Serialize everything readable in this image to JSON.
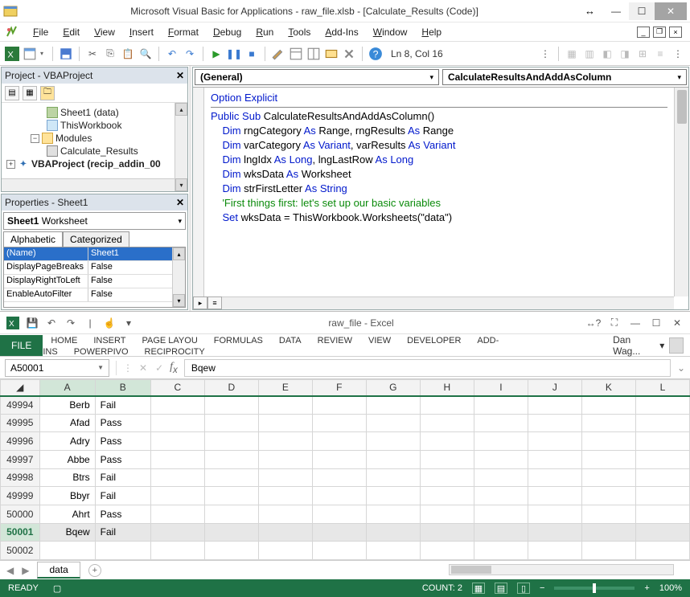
{
  "vba": {
    "title": "Microsoft Visual Basic for Applications - raw_file.xlsb - [Calculate_Results (Code)]",
    "menu": [
      "File",
      "Edit",
      "View",
      "Insert",
      "Format",
      "Debug",
      "Run",
      "Tools",
      "Add-Ins",
      "Window",
      "Help"
    ],
    "cursor_status": "Ln 8, Col 16",
    "project": {
      "title": "Project - VBAProject",
      "items": {
        "sheet1": "Sheet1 (data)",
        "thisworkbook": "ThisWorkbook",
        "modules_folder": "Modules",
        "module1": "Calculate_Results",
        "addin_project": "VBAProject (recip_addin_00"
      }
    },
    "properties": {
      "title": "Properties - Sheet1",
      "object_selector_name": "Sheet1",
      "object_selector_type": "Worksheet",
      "tabs": {
        "alpha": "Alphabetic",
        "cat": "Categorized"
      },
      "rows": [
        {
          "name": "(Name)",
          "value": "Sheet1",
          "selected": true
        },
        {
          "name": "DisplayPageBreaks",
          "value": "False"
        },
        {
          "name": "DisplayRightToLeft",
          "value": "False"
        },
        {
          "name": "EnableAutoFilter",
          "value": "False"
        }
      ]
    },
    "code": {
      "object_dropdown": "(General)",
      "proc_dropdown": "CalculateResultsAndAddAsColumn",
      "lines": [
        {
          "t": "Option Explicit",
          "k": [
            "Option",
            "Explicit"
          ]
        },
        {
          "t": "Public Sub CalculateResultsAndAddAsColumn()",
          "k": [
            "Public",
            "Sub"
          ]
        },
        {
          "t": ""
        },
        {
          "t": "    Dim rngCategory As Range, rngResults As Range",
          "k": [
            "Dim",
            "As",
            "As"
          ]
        },
        {
          "t": "    Dim varCategory As Variant, varResults As Variant",
          "k": [
            "Dim",
            "As",
            "Variant",
            "As",
            "Variant"
          ]
        },
        {
          "t": "    Dim lngIdx As Long, lngLastRow As Long",
          "k": [
            "Dim",
            "As",
            "Long",
            "As",
            "Long"
          ]
        },
        {
          "t": "    Dim wksData As Worksheet",
          "k": [
            "Dim",
            "As"
          ]
        },
        {
          "t": "    Dim strFirstLetter As String",
          "k": [
            "Dim",
            "As",
            "String"
          ]
        },
        {
          "t": ""
        },
        {
          "t": "    'First things first: let's set up our basic variables",
          "c": true
        },
        {
          "t": "    Set wksData = ThisWorkbook.Worksheets(\"data\")",
          "k": [
            "Set"
          ]
        }
      ]
    }
  },
  "excel": {
    "qat_title": "raw_file - Excel",
    "ribbon": {
      "file": "FILE",
      "tabs": [
        "HOME",
        "INSERT",
        "PAGE LAYOU",
        "FORMULAS",
        "DATA",
        "REVIEW",
        "VIEW",
        "DEVELOPER",
        "ADD-INS",
        "POWERPIVO",
        "RECIPROCITY"
      ],
      "user": "Dan Wag..."
    },
    "namebox": "A50001",
    "formula": "Bqew",
    "columns": [
      "A",
      "B",
      "C",
      "D",
      "E",
      "F",
      "G",
      "H",
      "I",
      "J",
      "K",
      "L"
    ],
    "rows": [
      {
        "r": "49994",
        "a": "Berb",
        "b": "Fail"
      },
      {
        "r": "49995",
        "a": "Afad",
        "b": "Pass"
      },
      {
        "r": "49996",
        "a": "Adry",
        "b": "Pass"
      },
      {
        "r": "49997",
        "a": "Abbe",
        "b": "Pass"
      },
      {
        "r": "49998",
        "a": "Btrs",
        "b": "Fail"
      },
      {
        "r": "49999",
        "a": "Bbyr",
        "b": "Fail"
      },
      {
        "r": "50000",
        "a": "Ahrt",
        "b": "Pass"
      },
      {
        "r": "50001",
        "a": "Bqew",
        "b": "Fail",
        "sel": true
      }
    ],
    "extra_row": "50002",
    "sheet_tab": "data",
    "status": {
      "ready": "READY",
      "count": "COUNT: 2",
      "zoom": "100%"
    }
  }
}
